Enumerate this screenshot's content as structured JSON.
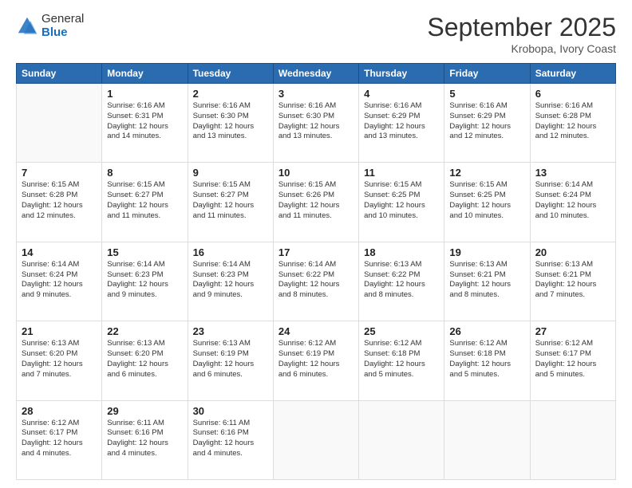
{
  "logo": {
    "general": "General",
    "blue": "Blue"
  },
  "title": "September 2025",
  "location": "Krobopa, Ivory Coast",
  "weekdays": [
    "Sunday",
    "Monday",
    "Tuesday",
    "Wednesday",
    "Thursday",
    "Friday",
    "Saturday"
  ],
  "weeks": [
    [
      {
        "day": "",
        "info": ""
      },
      {
        "day": "1",
        "info": "Sunrise: 6:16 AM\nSunset: 6:31 PM\nDaylight: 12 hours\nand 14 minutes."
      },
      {
        "day": "2",
        "info": "Sunrise: 6:16 AM\nSunset: 6:30 PM\nDaylight: 12 hours\nand 13 minutes."
      },
      {
        "day": "3",
        "info": "Sunrise: 6:16 AM\nSunset: 6:30 PM\nDaylight: 12 hours\nand 13 minutes."
      },
      {
        "day": "4",
        "info": "Sunrise: 6:16 AM\nSunset: 6:29 PM\nDaylight: 12 hours\nand 13 minutes."
      },
      {
        "day": "5",
        "info": "Sunrise: 6:16 AM\nSunset: 6:29 PM\nDaylight: 12 hours\nand 12 minutes."
      },
      {
        "day": "6",
        "info": "Sunrise: 6:16 AM\nSunset: 6:28 PM\nDaylight: 12 hours\nand 12 minutes."
      }
    ],
    [
      {
        "day": "7",
        "info": "Sunrise: 6:15 AM\nSunset: 6:28 PM\nDaylight: 12 hours\nand 12 minutes."
      },
      {
        "day": "8",
        "info": "Sunrise: 6:15 AM\nSunset: 6:27 PM\nDaylight: 12 hours\nand 11 minutes."
      },
      {
        "day": "9",
        "info": "Sunrise: 6:15 AM\nSunset: 6:27 PM\nDaylight: 12 hours\nand 11 minutes."
      },
      {
        "day": "10",
        "info": "Sunrise: 6:15 AM\nSunset: 6:26 PM\nDaylight: 12 hours\nand 11 minutes."
      },
      {
        "day": "11",
        "info": "Sunrise: 6:15 AM\nSunset: 6:25 PM\nDaylight: 12 hours\nand 10 minutes."
      },
      {
        "day": "12",
        "info": "Sunrise: 6:15 AM\nSunset: 6:25 PM\nDaylight: 12 hours\nand 10 minutes."
      },
      {
        "day": "13",
        "info": "Sunrise: 6:14 AM\nSunset: 6:24 PM\nDaylight: 12 hours\nand 10 minutes."
      }
    ],
    [
      {
        "day": "14",
        "info": "Sunrise: 6:14 AM\nSunset: 6:24 PM\nDaylight: 12 hours\nand 9 minutes."
      },
      {
        "day": "15",
        "info": "Sunrise: 6:14 AM\nSunset: 6:23 PM\nDaylight: 12 hours\nand 9 minutes."
      },
      {
        "day": "16",
        "info": "Sunrise: 6:14 AM\nSunset: 6:23 PM\nDaylight: 12 hours\nand 9 minutes."
      },
      {
        "day": "17",
        "info": "Sunrise: 6:14 AM\nSunset: 6:22 PM\nDaylight: 12 hours\nand 8 minutes."
      },
      {
        "day": "18",
        "info": "Sunrise: 6:13 AM\nSunset: 6:22 PM\nDaylight: 12 hours\nand 8 minutes."
      },
      {
        "day": "19",
        "info": "Sunrise: 6:13 AM\nSunset: 6:21 PM\nDaylight: 12 hours\nand 8 minutes."
      },
      {
        "day": "20",
        "info": "Sunrise: 6:13 AM\nSunset: 6:21 PM\nDaylight: 12 hours\nand 7 minutes."
      }
    ],
    [
      {
        "day": "21",
        "info": "Sunrise: 6:13 AM\nSunset: 6:20 PM\nDaylight: 12 hours\nand 7 minutes."
      },
      {
        "day": "22",
        "info": "Sunrise: 6:13 AM\nSunset: 6:20 PM\nDaylight: 12 hours\nand 6 minutes."
      },
      {
        "day": "23",
        "info": "Sunrise: 6:13 AM\nSunset: 6:19 PM\nDaylight: 12 hours\nand 6 minutes."
      },
      {
        "day": "24",
        "info": "Sunrise: 6:12 AM\nSunset: 6:19 PM\nDaylight: 12 hours\nand 6 minutes."
      },
      {
        "day": "25",
        "info": "Sunrise: 6:12 AM\nSunset: 6:18 PM\nDaylight: 12 hours\nand 5 minutes."
      },
      {
        "day": "26",
        "info": "Sunrise: 6:12 AM\nSunset: 6:18 PM\nDaylight: 12 hours\nand 5 minutes."
      },
      {
        "day": "27",
        "info": "Sunrise: 6:12 AM\nSunset: 6:17 PM\nDaylight: 12 hours\nand 5 minutes."
      }
    ],
    [
      {
        "day": "28",
        "info": "Sunrise: 6:12 AM\nSunset: 6:17 PM\nDaylight: 12 hours\nand 4 minutes."
      },
      {
        "day": "29",
        "info": "Sunrise: 6:11 AM\nSunset: 6:16 PM\nDaylight: 12 hours\nand 4 minutes."
      },
      {
        "day": "30",
        "info": "Sunrise: 6:11 AM\nSunset: 6:16 PM\nDaylight: 12 hours\nand 4 minutes."
      },
      {
        "day": "",
        "info": ""
      },
      {
        "day": "",
        "info": ""
      },
      {
        "day": "",
        "info": ""
      },
      {
        "day": "",
        "info": ""
      }
    ]
  ]
}
